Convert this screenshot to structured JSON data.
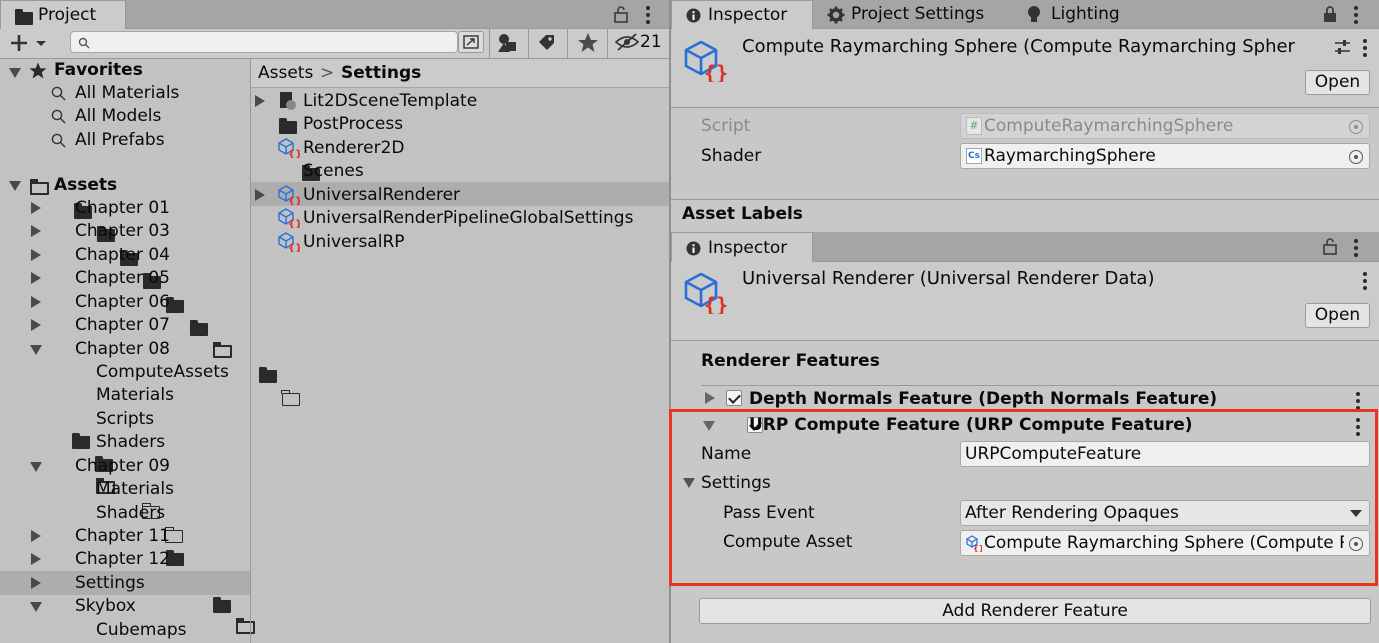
{
  "project_panel": {
    "tab_label": "Project",
    "search_placeholder": "",
    "hidden_count": "21",
    "favorites": {
      "label": "Favorites",
      "items": [
        "All Materials",
        "All Models",
        "All Prefabs"
      ]
    },
    "assets_label": "Assets",
    "tree": [
      "Chapter 01",
      "Chapter 03",
      "Chapter 04",
      "Chapter 05",
      "Chapter 06",
      "Chapter 07",
      "Chapter 08",
      "ComputeAssets",
      "Materials",
      "Scripts",
      "Shaders",
      "Chapter 09",
      "Materials",
      "Shaders",
      "Chapter 11",
      "Chapter 12",
      "Settings",
      "Skybox",
      "Cubemaps"
    ],
    "breadcrumb": {
      "root": "Assets",
      "separator": ">",
      "current": "Settings"
    },
    "files": [
      "Lit2DSceneTemplate",
      "PostProcess",
      "Renderer2D",
      "Scenes",
      "UniversalRenderer",
      "UniversalRenderPipelineGlobalSettings",
      "UniversalRP"
    ]
  },
  "inspector_top": {
    "tabs": [
      "Inspector",
      "Project Settings",
      "Lighting"
    ],
    "title": "Compute Raymarching Sphere (Compute Raymarching Spher",
    "open_label": "Open",
    "script_label": "Script",
    "script_value": "ComputeRaymarchingSphere",
    "shader_label": "Shader",
    "shader_value": "RaymarchingSphere",
    "asset_labels": "Asset Labels"
  },
  "inspector_bottom": {
    "tab_label": "Inspector",
    "title": "Universal Renderer (Universal Renderer Data)",
    "open_label": "Open",
    "section_title": "Renderer Features",
    "feature1": "Depth Normals Feature (Depth Normals Feature)",
    "feature2": "URP Compute Feature (URP Compute Feature)",
    "name_label": "Name",
    "name_value": "URPComputeFeature",
    "settings_label": "Settings",
    "pass_event_label": "Pass Event",
    "pass_event_value": "After Rendering Opaques",
    "compute_asset_label": "Compute Asset",
    "compute_asset_value": "Compute Raymarching Sphere (Compute R",
    "add_button": "Add Renderer Feature"
  },
  "colors": {
    "highlight_border": "#e8361e",
    "asset_icon_blue": "#2a6fd6",
    "asset_icon_red": "#d93025",
    "selected_row": "#adadad"
  }
}
